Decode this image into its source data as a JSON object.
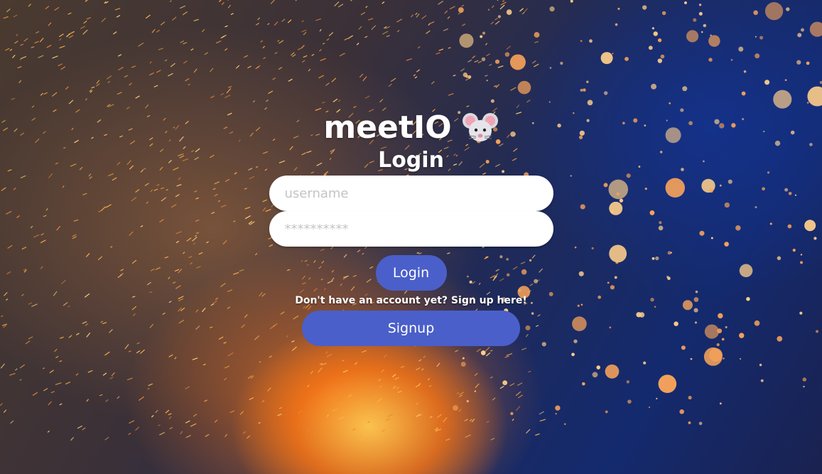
{
  "app": {
    "brand_name": "meetIO",
    "brand_icon": "mouse-icon"
  },
  "login_form": {
    "heading": "Login",
    "username_placeholder": "username",
    "password_placeholder": "**********",
    "login_button": "Login",
    "signup_prompt": "Don't have an account yet? Sign up here!",
    "signup_button": "Signup"
  },
  "colors": {
    "button": "#4a5fc9",
    "field_bg": "#ffffff",
    "text": "#ffffff"
  }
}
